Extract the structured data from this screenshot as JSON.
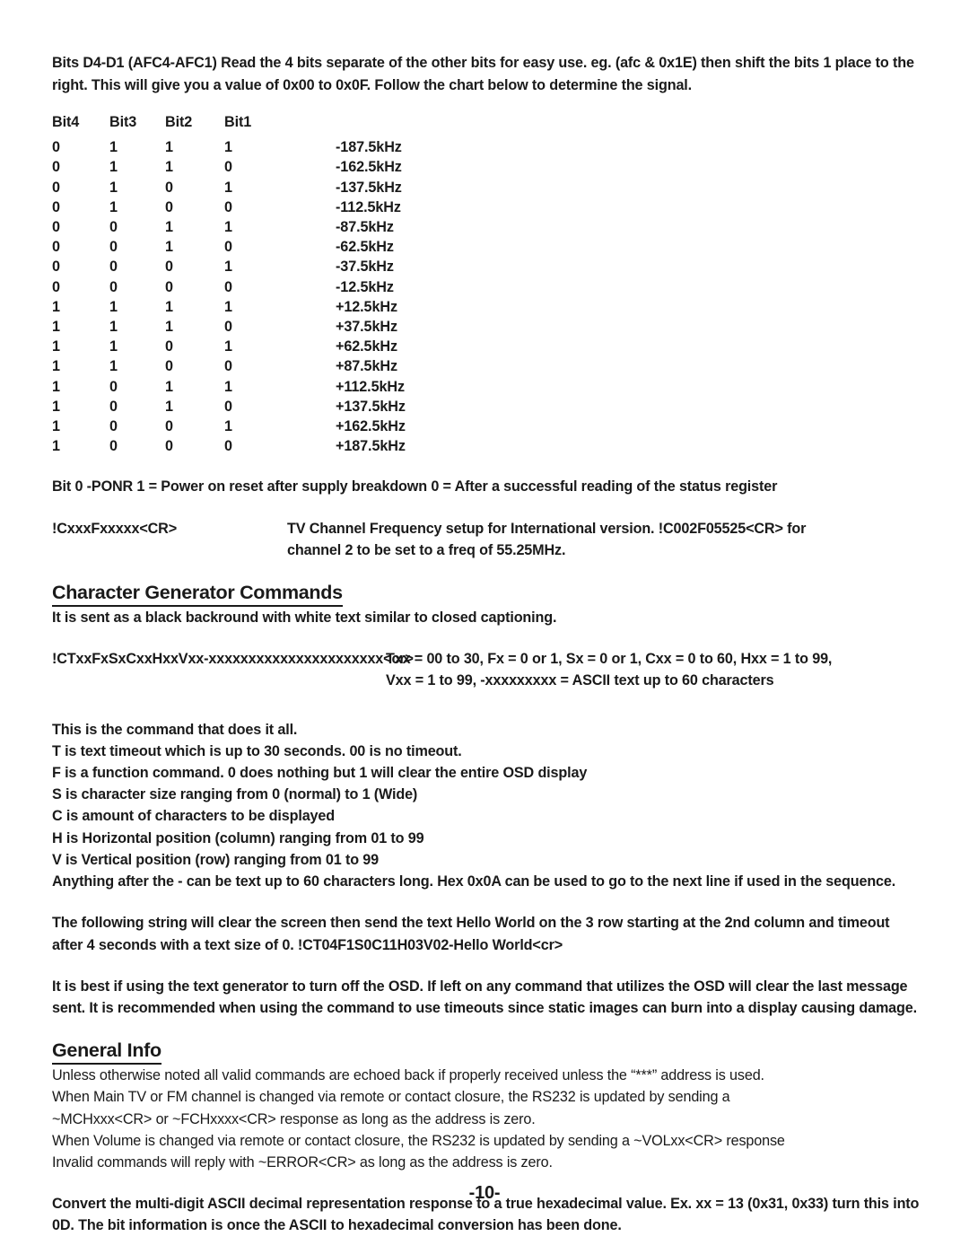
{
  "document": {
    "intro_paragraph": "Bits D4-D1 (AFC4-AFC1)  Read the 4 bits separate of the other bits for easy use.  eg. (afc & 0x1E) then shift the bits 1 place to the right. This will give you a value of 0x00 to 0x0F.  Follow the chart below to determine the signal."
  },
  "bit_table": {
    "headers": [
      "Bit4",
      "Bit3",
      "Bit2",
      "Bit1",
      ""
    ],
    "rows": [
      [
        "0",
        "1",
        "1",
        "1",
        "-187.5kHz"
      ],
      [
        "0",
        "1",
        "1",
        "0",
        "-162.5kHz"
      ],
      [
        "0",
        "1",
        "0",
        "1",
        "-137.5kHz"
      ],
      [
        "0",
        "1",
        "0",
        "0",
        "-112.5kHz"
      ],
      [
        "0",
        "0",
        "1",
        "1",
        "-87.5kHz"
      ],
      [
        "0",
        "0",
        "1",
        "0",
        "-62.5kHz"
      ],
      [
        "0",
        "0",
        "0",
        "1",
        "-37.5kHz"
      ],
      [
        "0",
        "0",
        "0",
        "0",
        "-12.5kHz"
      ],
      [
        "1",
        "1",
        "1",
        "1",
        "+12.5kHz"
      ],
      [
        "1",
        "1",
        "1",
        "0",
        "+37.5kHz"
      ],
      [
        "1",
        "1",
        "0",
        "1",
        "+62.5kHz"
      ],
      [
        "1",
        "1",
        "0",
        "0",
        "+87.5kHz"
      ],
      [
        "1",
        "0",
        "1",
        "1",
        "+112.5kHz"
      ],
      [
        "1",
        "0",
        "1",
        "0",
        "+137.5kHz"
      ],
      [
        "1",
        "0",
        "0",
        "1",
        "+162.5kHz"
      ],
      [
        "1",
        "0",
        "0",
        "0",
        "+187.5kHz"
      ]
    ]
  },
  "ponr": {
    "text": "Bit 0 -PONR  1 = Power on reset after supply breakdown  0 = After a successful reading of the status register"
  },
  "tv_channel_command": {
    "code": "!CxxxFxxxxx<CR>",
    "description_line1": "TV Channel Frequency setup for International version. !C002F05525<CR> for",
    "description_line2": "channel 2 to be set to a freq of 55.25MHz."
  },
  "character_generator": {
    "heading": "Character Generator Commands",
    "subtitle": "It is sent as a black backround with white text similar to closed captioning.",
    "command_code": "!CTxxFxSxCxxHxxVxx-xxxxxxxxxxxxxxxxxxxxxx<cr>",
    "command_desc_line1": "Txx = 00 to 30, Fx = 0 or 1, Sx = 0 or 1, Cxx = 0 to 60, Hxx = 1 to 99,",
    "command_desc_line2": "Vxx = 1 to 99, -xxxxxxxxx = ASCII text up to 60 characters",
    "description_lines": [
      "This is the command that does it all.",
      "T is text timeout which is up to 30 seconds.  00 is no timeout.",
      "F is a function command. 0 does nothing but 1 will clear the entire OSD display",
      "S is character size ranging from 0 (normal) to 1 (Wide)",
      "C is amount of characters to be displayed",
      "H is Horizontal position (column) ranging from 01 to 99",
      "V is Vertical position (row) ranging from 01 to 99",
      "Anything after the - can be text up to 60 characters long. Hex 0x0A can be used to go to the next line if used in the sequence."
    ],
    "example_paragraph": "The following string will clear the screen then send the text Hello World  on the 3 row starting at the 2nd column and timeout after 4 seconds with a text size of 0.  !CT04F1S0C11H03V02-Hello World<cr>",
    "osd_note": "It is best if using the text generator to turn off the OSD.  If left on any command that utilizes the OSD will clear the last message sent.  It is recommended when using the command to use timeouts since static images can burn into a display causing damage."
  },
  "general_info": {
    "heading": "General Info",
    "lines": [
      "Unless otherwise noted all valid commands are echoed back if properly received unless the “***” address is used.",
      "When Main TV or FM channel is changed via remote or contact closure, the RS232 is updated by sending a",
      "~MCHxxx<CR> or ~FCHxxxx<CR> response as long as the address is zero.",
      "When Volume is changed via remote or contact closure, the RS232 is updated by sending a ~VOLxx<CR> response",
      "Invalid commands will reply with ~ERROR<CR> as long as the address is zero."
    ],
    "conversion_note": "Convert the multi-digit ASCII decimal representation response to a true hexadecimal value.  Ex. xx = 13 (0x31, 0x33) turn this into 0D.  The bit information is once the ASCII to hexadecimal conversion has been done."
  },
  "footer": {
    "page_number": "-10-"
  }
}
